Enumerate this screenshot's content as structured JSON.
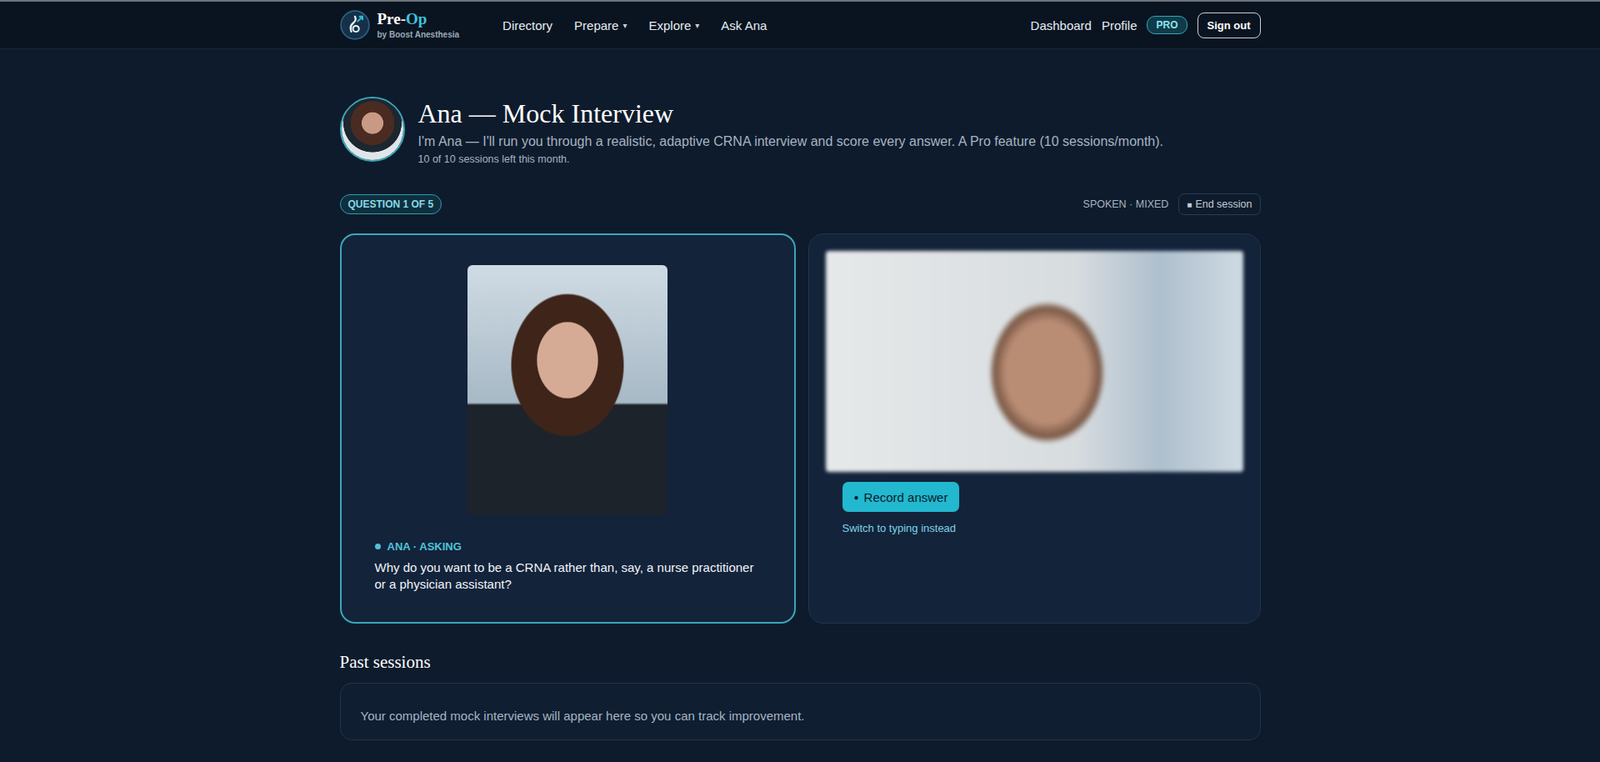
{
  "nav": {
    "logo": {
      "prefix": "Pre-",
      "suffix": "Op",
      "tagline": "by Boost Anesthesia"
    },
    "links": [
      {
        "label": "Directory"
      },
      {
        "label": "Prepare",
        "menu": "▾"
      },
      {
        "label": "Explore",
        "menu": "▾"
      },
      {
        "label": "Ask Ana"
      }
    ],
    "right": {
      "links": [
        "Dashboard",
        "Profile"
      ],
      "badge": "PRO",
      "button": "Sign out"
    }
  },
  "header": {
    "title": "Ana — Mock Interview",
    "subtitle": "I'm Ana — I'll run you through a realistic, adaptive CRNA interview and score every answer. A Pro feature (10 sessions/month).",
    "quota": "10 of 10 sessions left this month."
  },
  "session": {
    "progress": "QUESTION 1 OF 5",
    "mode": "SPOKEN · MIXED",
    "end": {
      "icon": "■",
      "label": "End session"
    }
  },
  "interviewer": {
    "status": "ANA · ASKING",
    "active": true,
    "question": "Why do you want to be a CRNA rather than, say, a nurse practitioner or a physician assistant?"
  },
  "answer": {
    "record": {
      "icon": "●",
      "label": "Record answer"
    },
    "switch": "Switch to typing instead"
  },
  "past": {
    "title": "Past sessions",
    "empty": "Your completed mock interviews will appear here so you can track improvement."
  }
}
